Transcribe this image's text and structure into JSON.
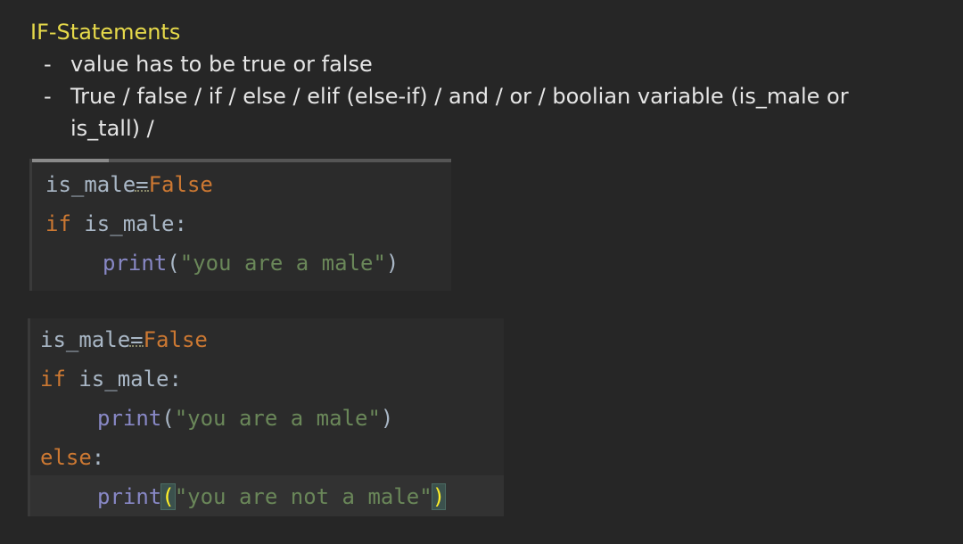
{
  "notes": {
    "title": "IF-Statements",
    "bullets": [
      {
        "dash": "-",
        "text": "value has to be true or false"
      },
      {
        "dash": "-",
        "text": "True / false / if / else / elif (else-if) / and / or / boolian variable (is_male or"
      },
      {
        "dash": "",
        "text": "is_tall) /"
      }
    ]
  },
  "code_block_1": {
    "line1": {
      "var": "is_male",
      "op": "=",
      "val": "False"
    },
    "line2": {
      "kw": "if",
      "rest": " is_male:"
    },
    "line3": {
      "fn": "print",
      "open": "(",
      "str": "\"you are a male\"",
      "close": ")"
    }
  },
  "code_block_2": {
    "line1": {
      "var": "is_male",
      "op": "=",
      "val": "False"
    },
    "line2": {
      "kw": "if",
      "rest": " is_male:"
    },
    "line3": {
      "fn": "print",
      "open": "(",
      "str": "\"you are a male\"",
      "close": ")"
    },
    "line4": {
      "kw": "else",
      "rest": ":"
    },
    "line5": {
      "fn": "print",
      "open": "(",
      "str": "\"you are not a male\"",
      "close": ")"
    }
  },
  "colors": {
    "background": "#262626",
    "title": "#e6d94a",
    "keyword": "#cc7832",
    "builtin": "#8888c6",
    "string": "#6a8759",
    "identifier": "#a9b7c6",
    "bracket_match": "#ffef28"
  }
}
